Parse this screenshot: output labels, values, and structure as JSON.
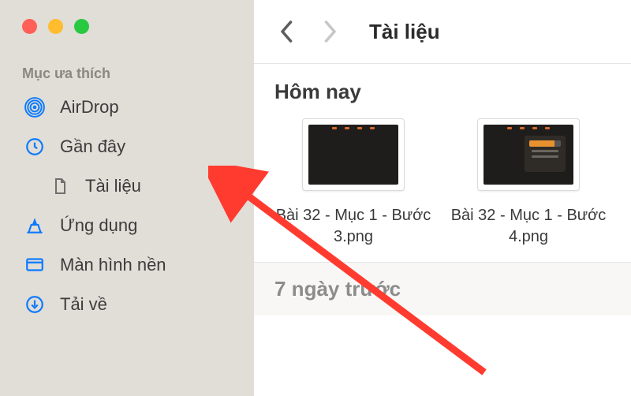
{
  "sidebar": {
    "section_label": "Mục ưa thích",
    "items": [
      {
        "label": "AirDrop"
      },
      {
        "label": "Gần đây"
      },
      {
        "label": "Tài liệu"
      },
      {
        "label": "Ứng dụng"
      },
      {
        "label": "Màn hình nền"
      },
      {
        "label": "Tải về"
      }
    ]
  },
  "toolbar": {
    "location": "Tài liệu"
  },
  "groups": {
    "today": "Hôm nay",
    "week": "7 ngày trước"
  },
  "files": [
    {
      "name": "Bài 32 - Mục 1 - Bước 3.png"
    },
    {
      "name": "Bài 32 - Mục 1 - Bước 4.png"
    }
  ]
}
